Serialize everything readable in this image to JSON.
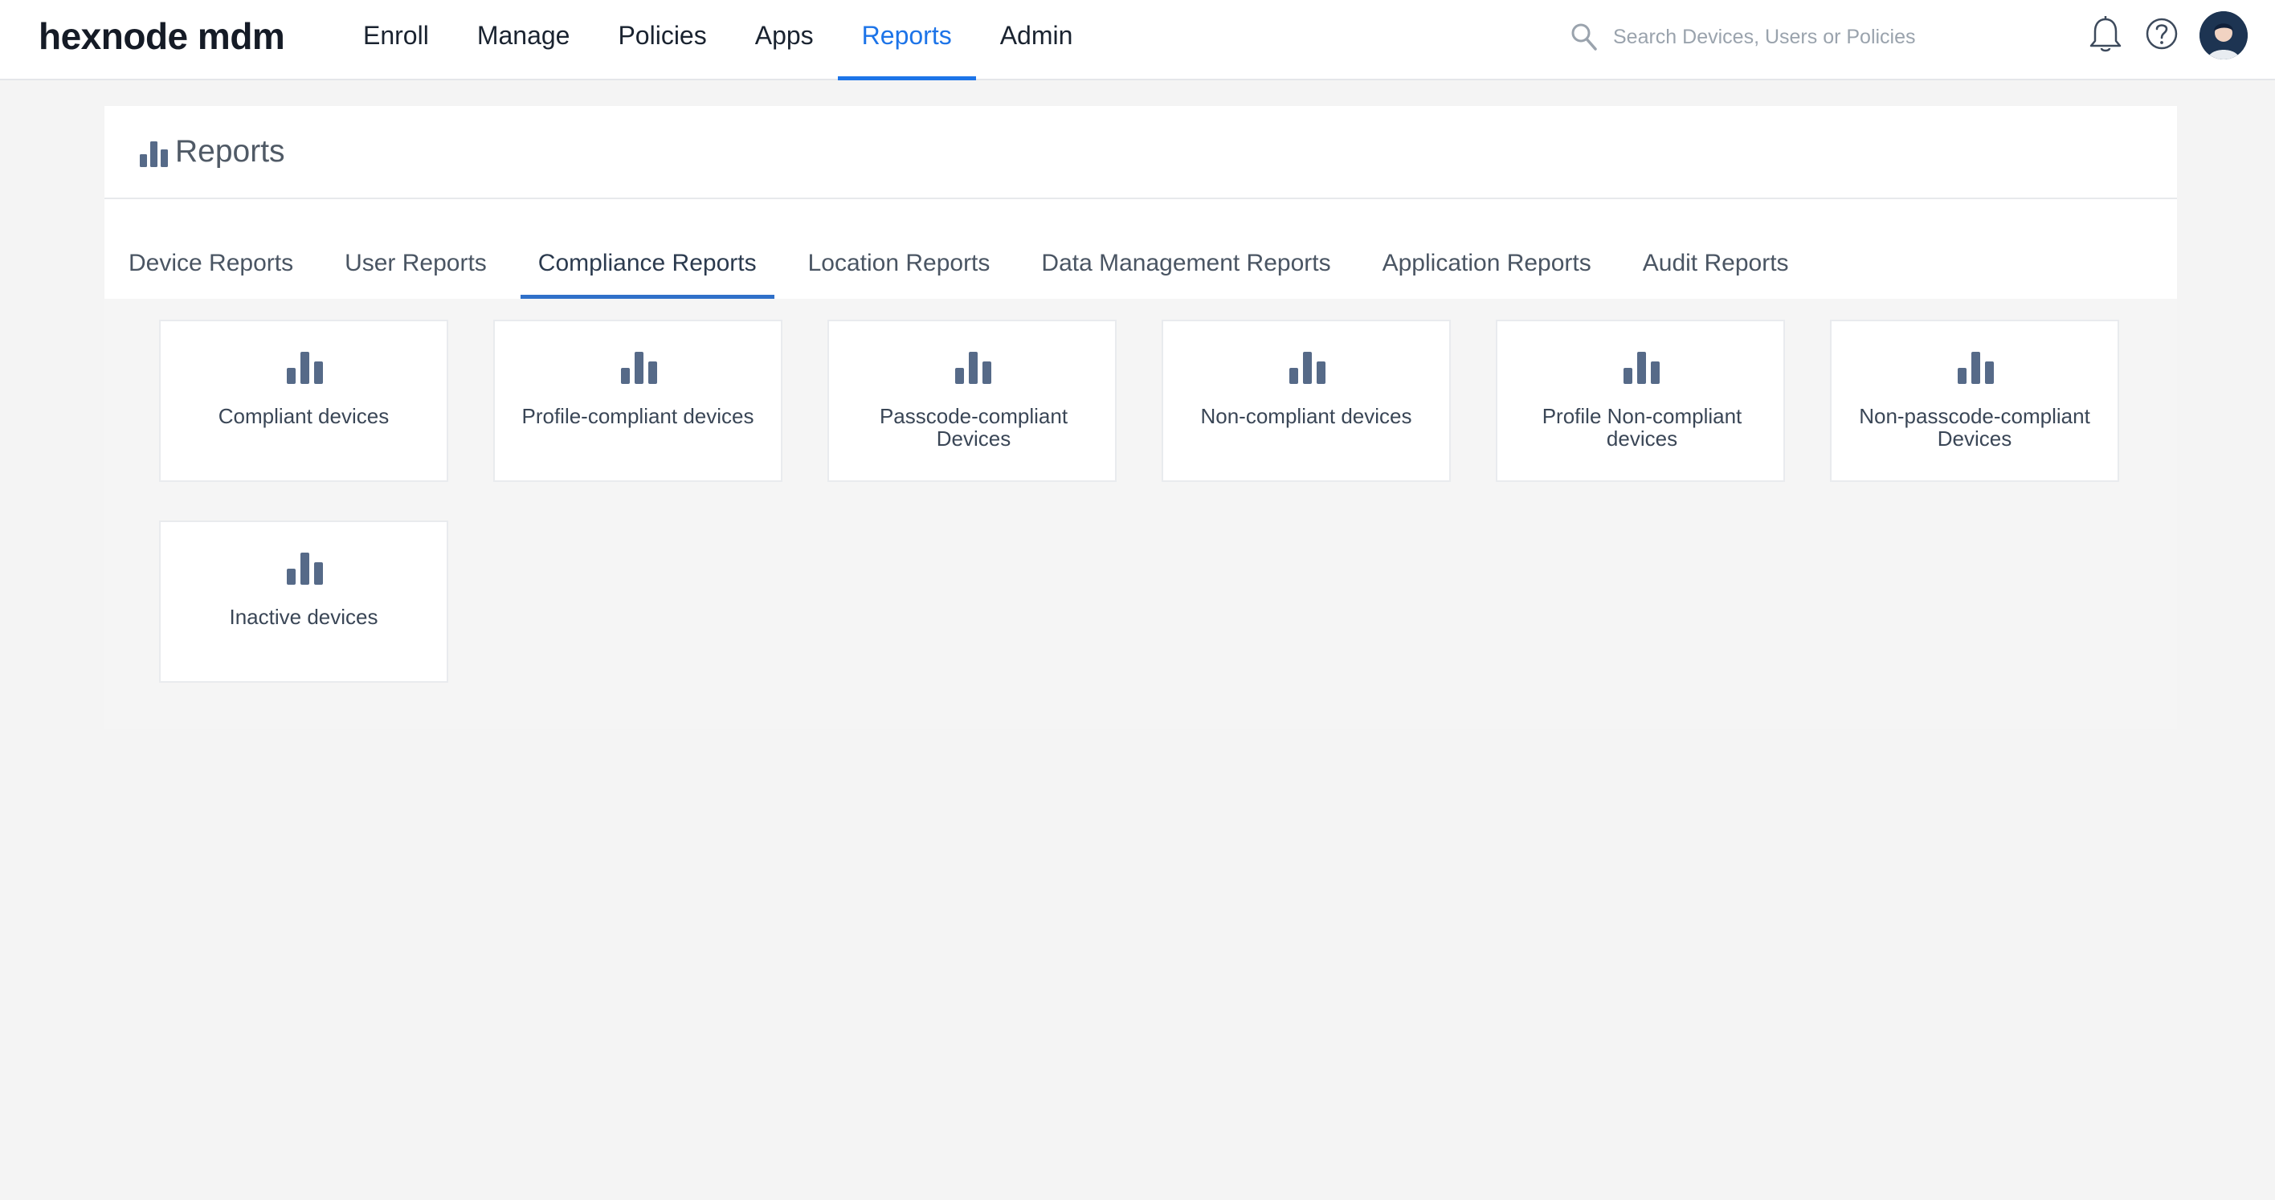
{
  "app": {
    "logo": "hexnode mdm"
  },
  "nav": {
    "items": [
      {
        "label": "Enroll"
      },
      {
        "label": "Manage"
      },
      {
        "label": "Policies"
      },
      {
        "label": "Apps"
      },
      {
        "label": "Reports",
        "active": true
      },
      {
        "label": "Admin"
      }
    ]
  },
  "search": {
    "placeholder": "Search Devices, Users or Policies",
    "value": ""
  },
  "header_icons": [
    "search-icon",
    "bell-icon",
    "help-icon",
    "avatar"
  ],
  "page": {
    "title": "Reports",
    "title_icon": "bar-chart-icon"
  },
  "tabs": [
    {
      "label": "Device Reports"
    },
    {
      "label": "User Reports"
    },
    {
      "label": "Compliance Reports",
      "active": true
    },
    {
      "label": "Location Reports"
    },
    {
      "label": "Data Management Reports"
    },
    {
      "label": "Application Reports"
    },
    {
      "label": "Audit Reports"
    }
  ],
  "cards": [
    {
      "label": "Compliant devices",
      "icon": "bar-chart-icon"
    },
    {
      "label": "Profile-compliant devices",
      "icon": "bar-chart-icon"
    },
    {
      "label": "Passcode-compliant Devices",
      "icon": "bar-chart-icon"
    },
    {
      "label": "Non-compliant devices",
      "icon": "bar-chart-icon"
    },
    {
      "label": "Profile Non-compliant devices",
      "icon": "bar-chart-icon"
    },
    {
      "label": "Non-passcode-compliant Devices",
      "icon": "bar-chart-icon"
    },
    {
      "label": "Inactive devices",
      "icon": "bar-chart-icon"
    }
  ],
  "colors": {
    "accent": "#1d74e8",
    "tab_underline": "#2f70c9",
    "icon": "#566a88",
    "background": "#f4f4f4"
  }
}
